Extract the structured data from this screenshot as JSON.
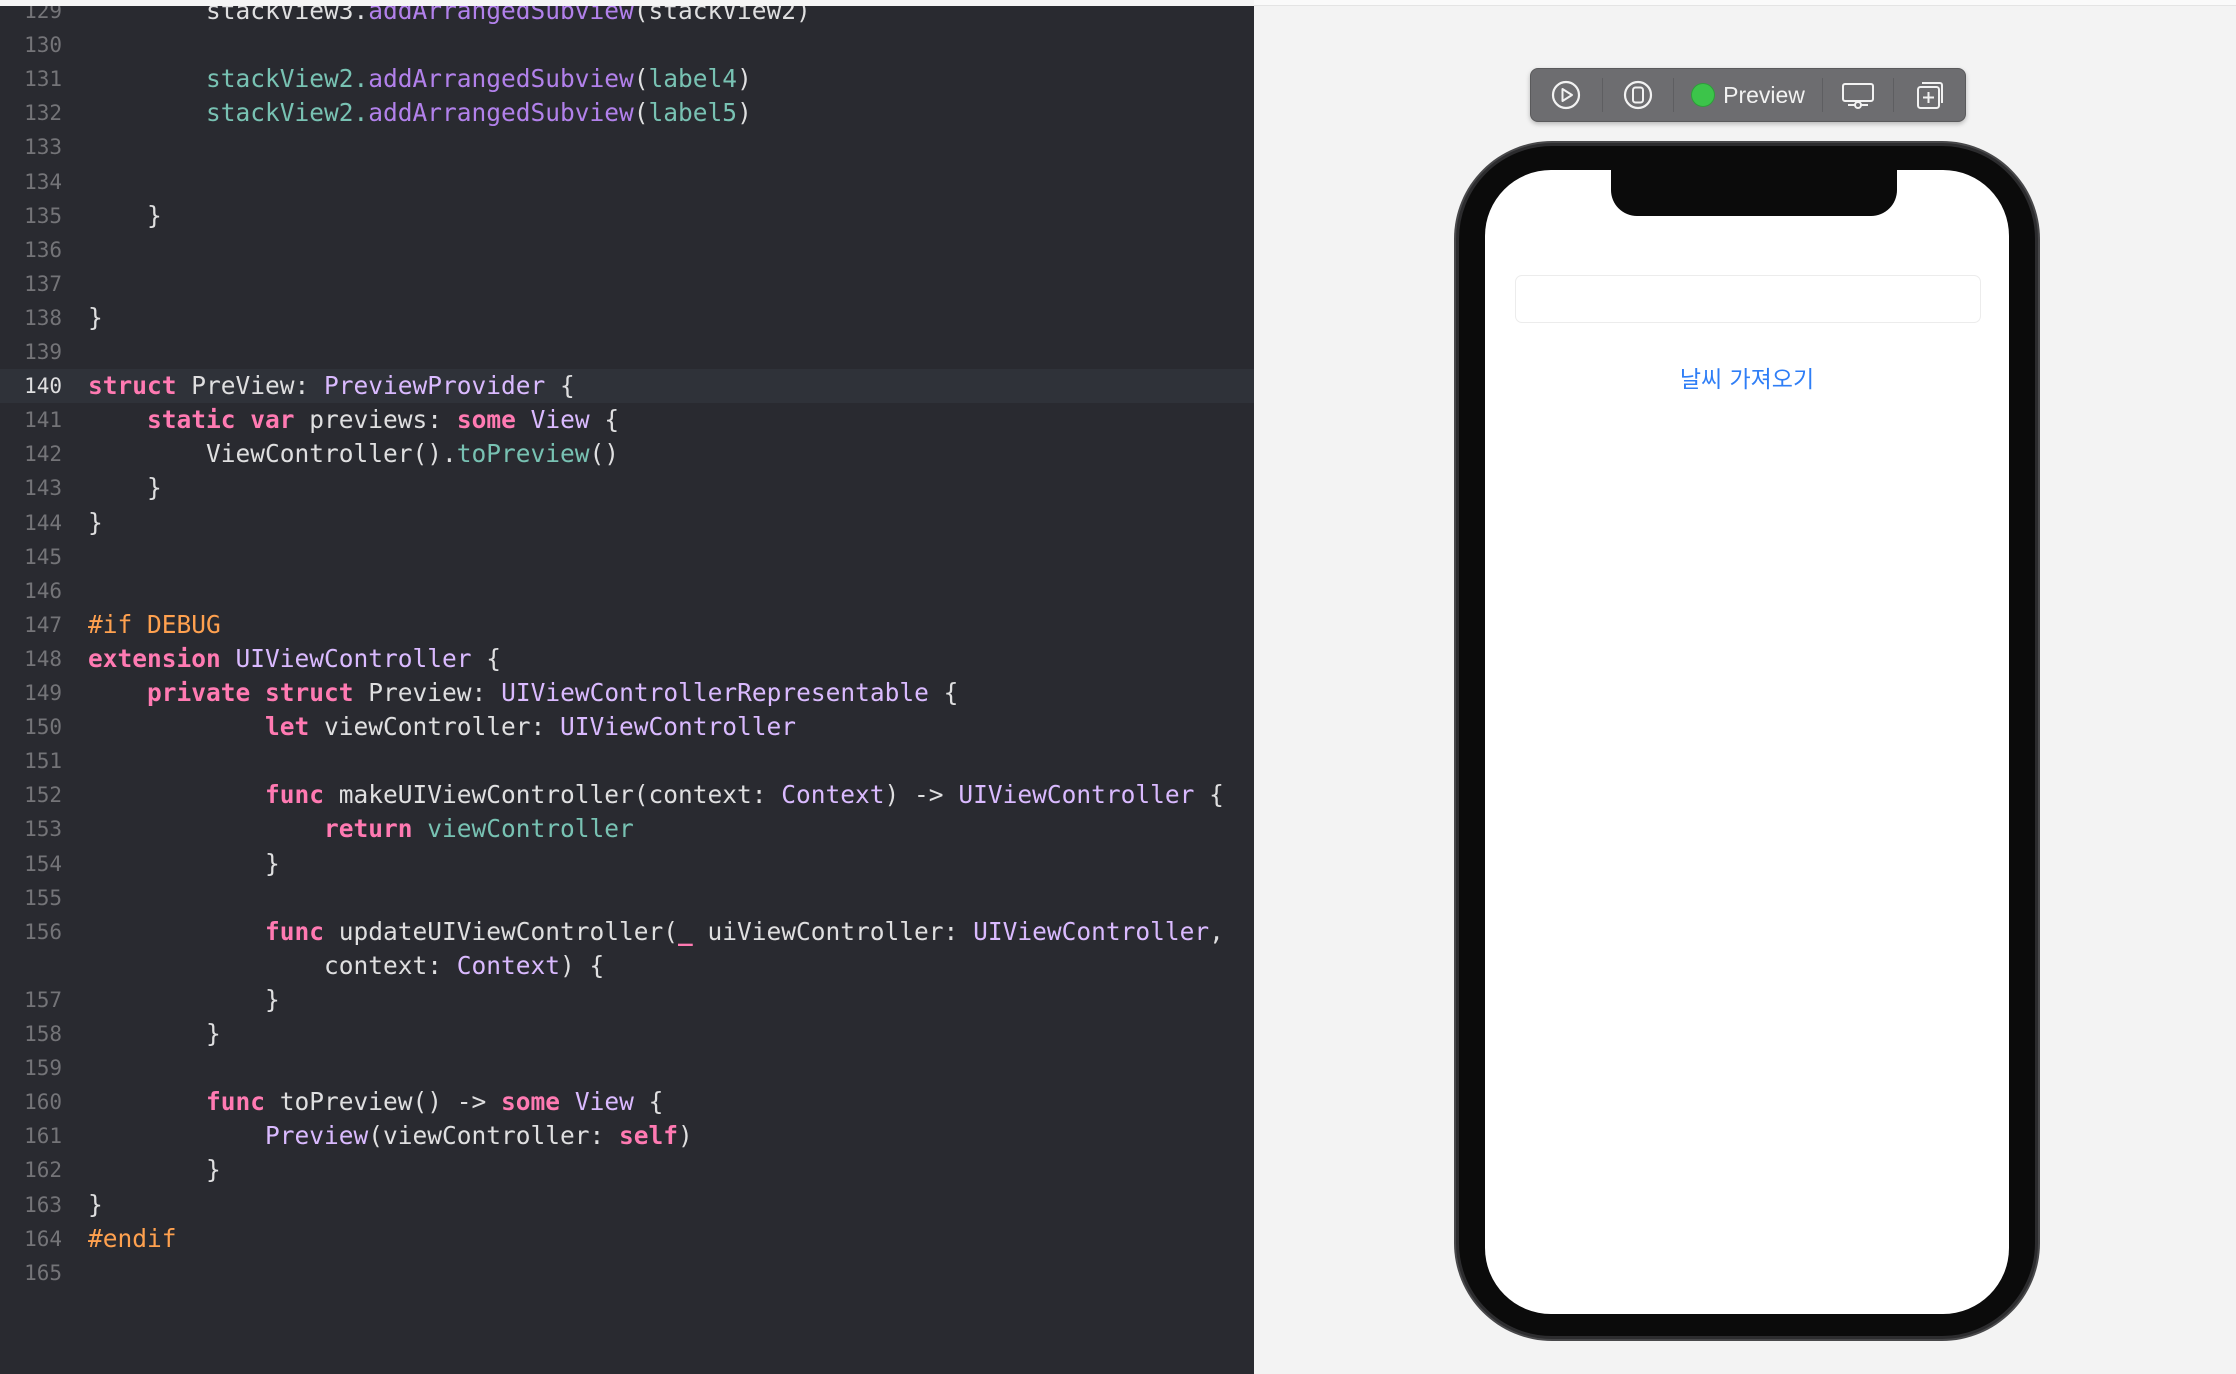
{
  "editor": {
    "current_line": 140,
    "lines": [
      {
        "n": "129",
        "indent": 8,
        "tokens": [
          {
            "t": "stackView3.",
            "c": "pl"
          },
          {
            "t": "addArrangedSubview",
            "c": "fn"
          },
          {
            "t": "(stackView2)",
            "c": "pl"
          }
        ]
      },
      {
        "n": "130",
        "indent": 0,
        "tokens": []
      },
      {
        "n": "131",
        "indent": 8,
        "tokens": [
          {
            "t": "stackView2.",
            "c": "pr"
          },
          {
            "t": "addArrangedSubview",
            "c": "fn"
          },
          {
            "t": "(",
            "c": "pl"
          },
          {
            "t": "label4",
            "c": "pr"
          },
          {
            "t": ")",
            "c": "pl"
          }
        ]
      },
      {
        "n": "132",
        "indent": 8,
        "tokens": [
          {
            "t": "stackView2.",
            "c": "pr"
          },
          {
            "t": "addArrangedSubview",
            "c": "fn"
          },
          {
            "t": "(",
            "c": "pl"
          },
          {
            "t": "label5",
            "c": "pr"
          },
          {
            "t": ")",
            "c": "pl"
          }
        ]
      },
      {
        "n": "133",
        "indent": 0,
        "tokens": []
      },
      {
        "n": "134",
        "indent": 0,
        "tokens": []
      },
      {
        "n": "135",
        "indent": 4,
        "tokens": [
          {
            "t": "}",
            "c": "pl"
          }
        ]
      },
      {
        "n": "136",
        "indent": 0,
        "tokens": []
      },
      {
        "n": "137",
        "indent": 0,
        "tokens": []
      },
      {
        "n": "138",
        "indent": 0,
        "tokens": [
          {
            "t": "}",
            "c": "pl"
          }
        ]
      },
      {
        "n": "139",
        "indent": 0,
        "tokens": []
      },
      {
        "n": "140",
        "indent": 0,
        "tokens": [
          {
            "t": "struct",
            "c": "kw"
          },
          {
            "t": " PreView: ",
            "c": "pl"
          },
          {
            "t": "PreviewProvider",
            "c": "ty"
          },
          {
            "t": " {",
            "c": "pl"
          }
        ]
      },
      {
        "n": "141",
        "indent": 4,
        "tokens": [
          {
            "t": "static",
            "c": "kw"
          },
          {
            "t": " ",
            "c": "pl"
          },
          {
            "t": "var",
            "c": "kw"
          },
          {
            "t": " previews: ",
            "c": "pl"
          },
          {
            "t": "some",
            "c": "kw"
          },
          {
            "t": " ",
            "c": "pl"
          },
          {
            "t": "View",
            "c": "ty"
          },
          {
            "t": " {",
            "c": "pl"
          }
        ]
      },
      {
        "n": "142",
        "indent": 8,
        "tokens": [
          {
            "t": "ViewController().",
            "c": "pl"
          },
          {
            "t": "toPreview",
            "c": "pr"
          },
          {
            "t": "()",
            "c": "pl"
          }
        ]
      },
      {
        "n": "143",
        "indent": 4,
        "tokens": [
          {
            "t": "}",
            "c": "pl"
          }
        ]
      },
      {
        "n": "144",
        "indent": 0,
        "tokens": [
          {
            "t": "}",
            "c": "pl"
          }
        ]
      },
      {
        "n": "145",
        "indent": 0,
        "tokens": []
      },
      {
        "n": "146",
        "indent": 0,
        "tokens": []
      },
      {
        "n": "147",
        "indent": 0,
        "tokens": [
          {
            "t": "#if DEBUG",
            "c": "pp"
          }
        ]
      },
      {
        "n": "148",
        "indent": 0,
        "tokens": [
          {
            "t": "extension",
            "c": "kw"
          },
          {
            "t": " ",
            "c": "pl"
          },
          {
            "t": "UIViewController",
            "c": "ty"
          },
          {
            "t": " {",
            "c": "pl"
          }
        ]
      },
      {
        "n": "149",
        "indent": 4,
        "tokens": [
          {
            "t": "private",
            "c": "kw"
          },
          {
            "t": " ",
            "c": "pl"
          },
          {
            "t": "struct",
            "c": "kw"
          },
          {
            "t": " Preview: ",
            "c": "pl"
          },
          {
            "t": "UIViewControllerRepresentable",
            "c": "ty"
          },
          {
            "t": " {",
            "c": "pl"
          }
        ]
      },
      {
        "n": "150",
        "indent": 12,
        "tokens": [
          {
            "t": "let",
            "c": "kw"
          },
          {
            "t": " viewController: ",
            "c": "pl"
          },
          {
            "t": "UIViewController",
            "c": "ty"
          }
        ]
      },
      {
        "n": "151",
        "indent": 0,
        "tokens": []
      },
      {
        "n": "152",
        "indent": 12,
        "tokens": [
          {
            "t": "func",
            "c": "kw"
          },
          {
            "t": " makeUIViewController(context: ",
            "c": "pl"
          },
          {
            "t": "Context",
            "c": "ty"
          },
          {
            "t": ") -> ",
            "c": "pl"
          },
          {
            "t": "UIViewController",
            "c": "ty"
          },
          {
            "t": " {",
            "c": "pl"
          }
        ]
      },
      {
        "n": "153",
        "indent": 16,
        "tokens": [
          {
            "t": "return",
            "c": "kw"
          },
          {
            "t": " ",
            "c": "pl"
          },
          {
            "t": "viewController",
            "c": "pr"
          }
        ]
      },
      {
        "n": "154",
        "indent": 12,
        "tokens": [
          {
            "t": "}",
            "c": "pl"
          }
        ]
      },
      {
        "n": "155",
        "indent": 0,
        "tokens": []
      },
      {
        "n": "156",
        "indent": 12,
        "tokens": [
          {
            "t": "func",
            "c": "kw"
          },
          {
            "t": " updateUIViewController(",
            "c": "pl"
          },
          {
            "t": "_",
            "c": "kw"
          },
          {
            "t": " uiViewController: ",
            "c": "pl"
          },
          {
            "t": "UIViewController",
            "c": "ty"
          },
          {
            "t": ",",
            "c": "pl"
          }
        ]
      },
      {
        "n": "",
        "indent": 16,
        "tokens": [
          {
            "t": "context: ",
            "c": "pl"
          },
          {
            "t": "Context",
            "c": "ty"
          },
          {
            "t": ") {",
            "c": "pl"
          }
        ]
      },
      {
        "n": "157",
        "indent": 12,
        "tokens": [
          {
            "t": "}",
            "c": "pl"
          }
        ]
      },
      {
        "n": "158",
        "indent": 8,
        "tokens": [
          {
            "t": "}",
            "c": "pl"
          }
        ]
      },
      {
        "n": "159",
        "indent": 0,
        "tokens": []
      },
      {
        "n": "160",
        "indent": 8,
        "tokens": [
          {
            "t": "func",
            "c": "kw"
          },
          {
            "t": " toPreview() -> ",
            "c": "pl"
          },
          {
            "t": "some",
            "c": "kw"
          },
          {
            "t": " ",
            "c": "pl"
          },
          {
            "t": "View",
            "c": "ty"
          },
          {
            "t": " {",
            "c": "pl"
          }
        ]
      },
      {
        "n": "161",
        "indent": 12,
        "tokens": [
          {
            "t": "Preview",
            "c": "ty"
          },
          {
            "t": "(viewController: ",
            "c": "pl"
          },
          {
            "t": "self",
            "c": "kw"
          },
          {
            "t": ")",
            "c": "pl"
          }
        ]
      },
      {
        "n": "162",
        "indent": 8,
        "tokens": [
          {
            "t": "}",
            "c": "pl"
          }
        ]
      },
      {
        "n": "163",
        "indent": 0,
        "tokens": [
          {
            "t": "}",
            "c": "pl"
          }
        ]
      },
      {
        "n": "164",
        "indent": 0,
        "tokens": [
          {
            "t": "#endif",
            "c": "pp"
          }
        ]
      },
      {
        "n": "165",
        "indent": 0,
        "tokens": []
      }
    ]
  },
  "preview_toolbar": {
    "live_icon": "play-circle-icon",
    "selectable_icon": "device-select-icon",
    "mode_label": "Preview",
    "mode_status_color": "#3cc44a",
    "device_settings_icon": "display-settings-icon",
    "duplicate_icon": "duplicate-preview-icon"
  },
  "app_preview": {
    "text_field_value": "",
    "fetch_button_label": "날씨 가져오기",
    "accent_color": "#2f7ef6"
  }
}
